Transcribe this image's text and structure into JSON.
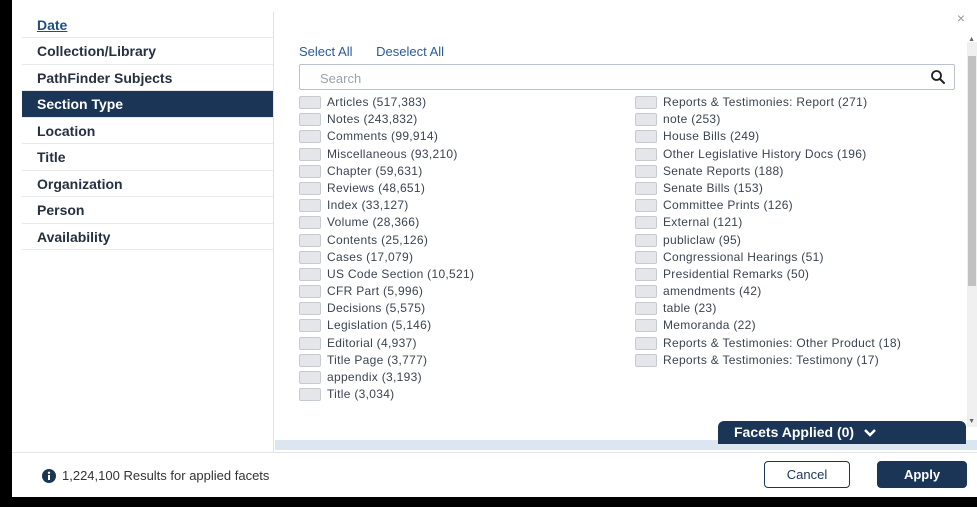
{
  "sidebar": {
    "items": [
      {
        "label": "Date"
      },
      {
        "label": "Collection/Library"
      },
      {
        "label": "PathFinder Subjects"
      },
      {
        "label": "Section Type"
      },
      {
        "label": "Location"
      },
      {
        "label": "Title"
      },
      {
        "label": "Organization"
      },
      {
        "label": "Person"
      },
      {
        "label": "Availability"
      }
    ]
  },
  "content": {
    "select_all": "Select All",
    "deselect_all": "Deselect All",
    "search_placeholder": "Search",
    "left_options": [
      {
        "label": "Articles (517,383)"
      },
      {
        "label": "Notes (243,832)"
      },
      {
        "label": "Comments (99,914)"
      },
      {
        "label": "Miscellaneous (93,210)"
      },
      {
        "label": "Chapter (59,631)"
      },
      {
        "label": "Reviews (48,651)"
      },
      {
        "label": "Index (33,127)"
      },
      {
        "label": "Volume (28,366)"
      },
      {
        "label": "Contents (25,126)"
      },
      {
        "label": "Cases (17,079)"
      },
      {
        "label": "US Code Section (10,521)"
      },
      {
        "label": "CFR Part (5,996)"
      },
      {
        "label": "Decisions (5,575)"
      },
      {
        "label": "Legislation (5,146)"
      },
      {
        "label": "Editorial (4,937)"
      },
      {
        "label": "Title Page (3,777)"
      },
      {
        "label": "appendix (3,193)"
      },
      {
        "label": "Title (3,034)"
      }
    ],
    "right_options": [
      {
        "label": "Reports & Testimonies: Report (271)"
      },
      {
        "label": "note (253)"
      },
      {
        "label": "House Bills (249)"
      },
      {
        "label": "Other Legislative History Docs (196)"
      },
      {
        "label": "Senate Reports (188)"
      },
      {
        "label": "Senate Bills (153)"
      },
      {
        "label": "Committee Prints (126)"
      },
      {
        "label": "External (121)"
      },
      {
        "label": "publiclaw (95)"
      },
      {
        "label": "Congressional Hearings (51)"
      },
      {
        "label": "Presidential Remarks (50)"
      },
      {
        "label": "amendments (42)"
      },
      {
        "label": "table (23)"
      },
      {
        "label": "Memoranda (22)"
      },
      {
        "label": "Reports & Testimonies: Other Product (18)"
      },
      {
        "label": "Reports & Testimonies: Testimony (17)"
      }
    ]
  },
  "facets_applied": "Facets Applied (0)",
  "footer": {
    "results_text": "1,224,100 Results for applied facets",
    "cancel_label": "Cancel",
    "apply_label": "Apply"
  },
  "close_glyph": "×",
  "colors": {
    "navy": "#1b3557",
    "link": "#2a5a9a"
  }
}
